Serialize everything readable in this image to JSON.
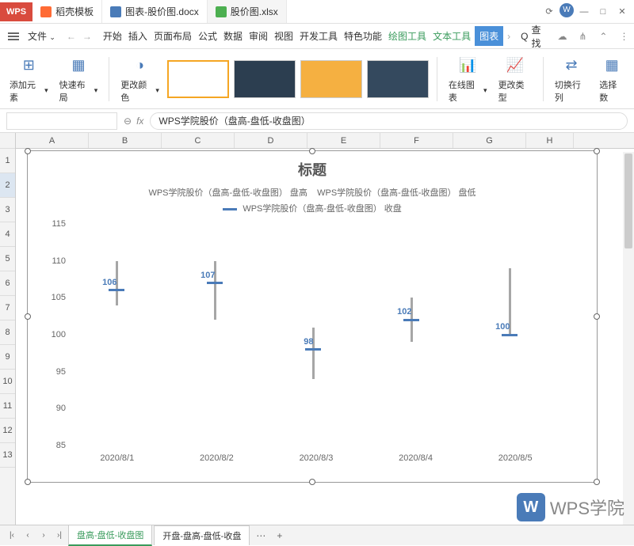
{
  "titlebar": {
    "logo": "WPS",
    "tabs": [
      {
        "icon": "fire",
        "label": "稻壳模板"
      },
      {
        "icon": "word",
        "label": "图表-股价图.docx"
      },
      {
        "icon": "excel",
        "label": "股价图.xlsx"
      }
    ]
  },
  "menubar": {
    "file": "文件",
    "items": [
      "开始",
      "插入",
      "页面布局",
      "公式",
      "数据",
      "审阅",
      "视图",
      "开发工具",
      "特色功能"
    ],
    "drawing": "绘图工具",
    "text_tool": "文本工具",
    "chart_tab": "图表",
    "search": "查找"
  },
  "ribbon": {
    "add_element": "添加元素",
    "quick_layout": "快速布局",
    "change_colors": "更改颜色",
    "online_chart": "在线图表",
    "change_type": "更改类型",
    "switch_rc": "切换行列",
    "select_data": "选择数"
  },
  "formula_bar": {
    "fx": "fx",
    "value": "WPS学院股价（盘高-盘低-收盘图）"
  },
  "columns": [
    "A",
    "B",
    "C",
    "D",
    "E",
    "F",
    "G",
    "H"
  ],
  "rows": [
    "1",
    "2",
    "3",
    "4",
    "5",
    "6",
    "7",
    "8",
    "9",
    "10",
    "11",
    "12",
    "13"
  ],
  "chart_data": {
    "type": "hlc-stock",
    "title": "标题",
    "legend": {
      "high": "WPS学院股价（盘高-盘低-收盘图）  盘高",
      "low": "WPS学院股价（盘高-盘低-收盘图）  盘低",
      "close": "WPS学院股价（盘高-盘低-收盘图）  收盘"
    },
    "categories": [
      "2020/8/1",
      "2020/8/2",
      "2020/8/3",
      "2020/8/4",
      "2020/8/5"
    ],
    "series": [
      {
        "name": "盘高",
        "values": [
          110,
          110,
          101,
          105,
          109
        ]
      },
      {
        "name": "盘低",
        "values": [
          104,
          102,
          94,
          99,
          100
        ]
      },
      {
        "name": "收盘",
        "values": [
          106,
          107,
          98,
          102,
          100
        ]
      }
    ],
    "data_labels": [
      106,
      107,
      98,
      102,
      100
    ],
    "ylim": [
      85,
      115
    ],
    "y_ticks": [
      85,
      90,
      95,
      100,
      105,
      110,
      115
    ],
    "xlabel": "",
    "ylabel": ""
  },
  "sheet_tabs": {
    "active": "盘高-盘低-收盘图",
    "other": "开盘-盘高-盘低-收盘"
  },
  "watermark": "WPS学院"
}
